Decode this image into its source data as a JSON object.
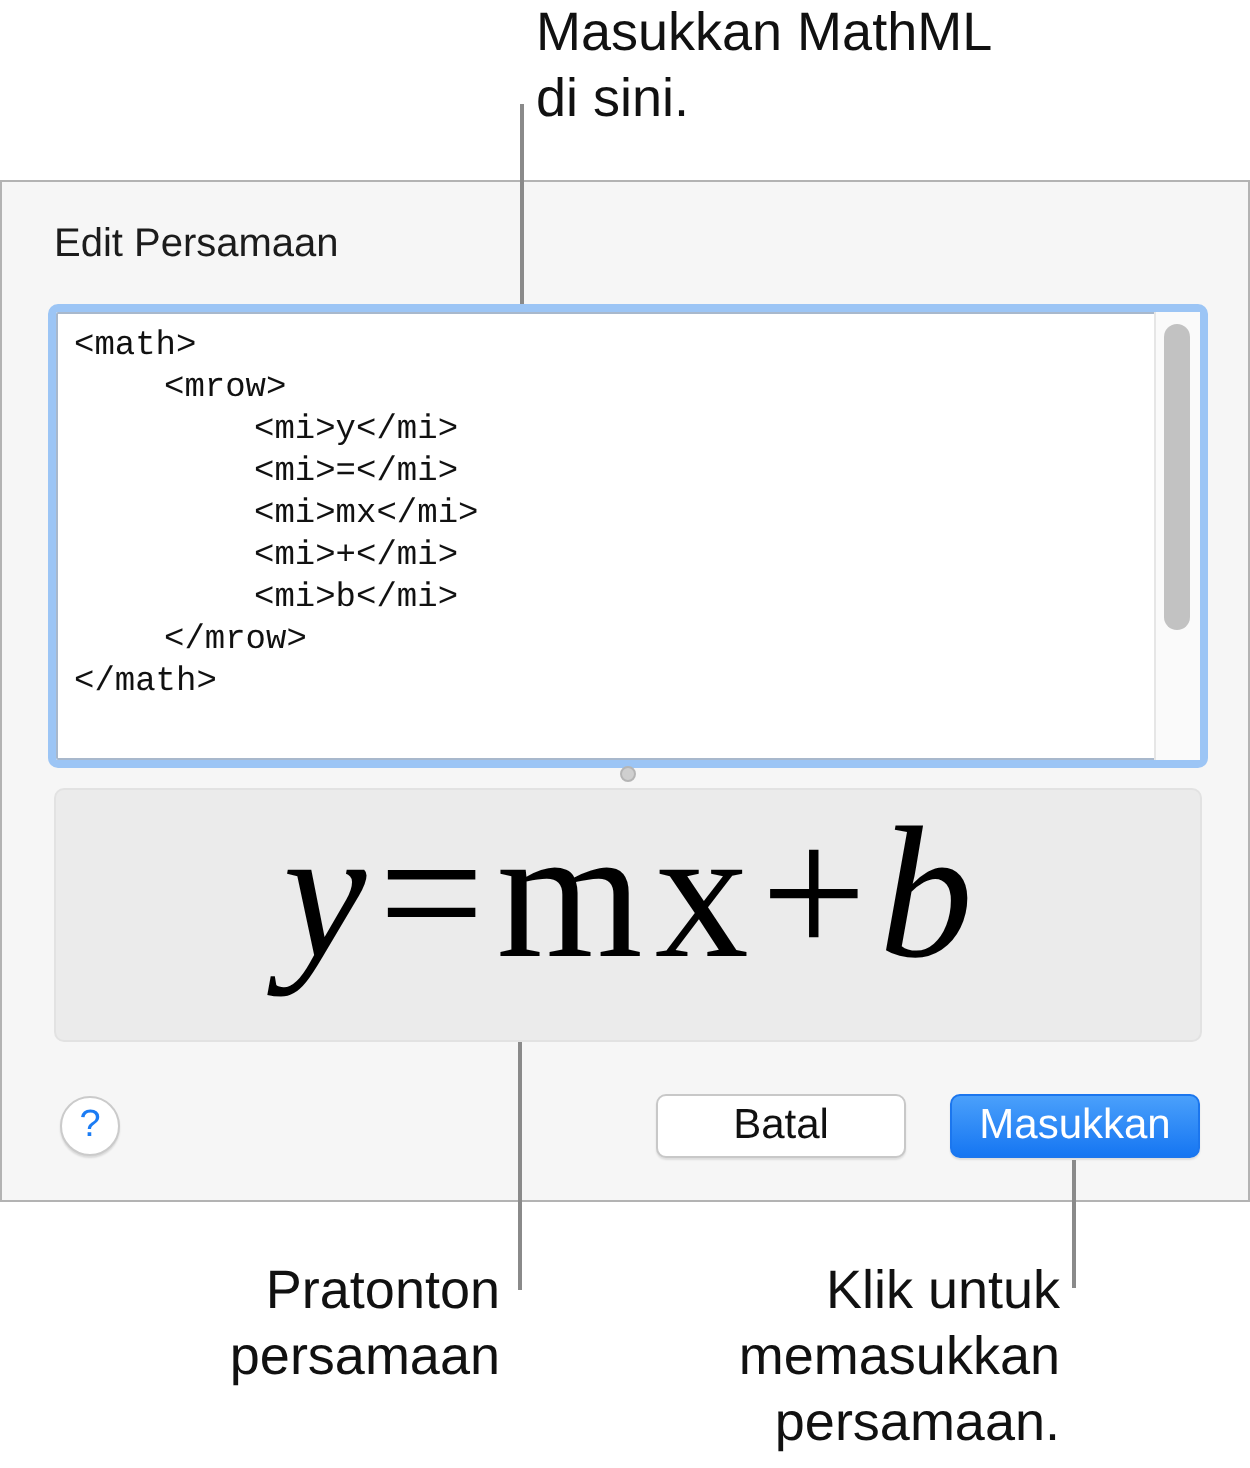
{
  "editor_callout": "Masukkan MathML di sini.",
  "dialog": {
    "title": "Edit Persamaan",
    "mathml_field": {
      "focused": true,
      "lines": [
        {
          "text": "<math>",
          "children": [
            {
              "text": "<mrow>",
              "children": [
                {
                  "text": "<mi>y</mi>"
                },
                {
                  "text": "<mi>=</mi>"
                },
                {
                  "text": "<mi>mx</mi>"
                },
                {
                  "text": "<mi>+</mi>"
                },
                {
                  "text": "<mi>b</mi>"
                }
              ]
            },
            {
              "text": "</mrow>"
            }
          ]
        },
        {
          "text": "</math>"
        }
      ]
    },
    "preview": {
      "equation": "*y*=mx+*b*"
    },
    "help_button": {
      "label": "?"
    },
    "buttons": [
      {
        "label": "Batal",
        "primary": false
      },
      {
        "label": "Masukkan",
        "primary": true
      }
    ]
  },
  "preview_callout": "Pratonton persamaan",
  "insert_callout": "Klik untuk memasukkan persamaan."
}
